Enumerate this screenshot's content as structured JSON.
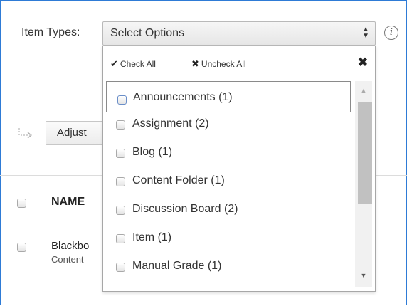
{
  "filter": {
    "label": "Item Types:",
    "select_value": "Select Options",
    "select_arrows": "▲\n▼",
    "info_glyph": "i"
  },
  "toolbar": {
    "adjust_label": "Adjust"
  },
  "table": {
    "name_header": "NAME",
    "rows": [
      {
        "title": "Blackbo",
        "subtitle": "Content"
      }
    ]
  },
  "dropdown": {
    "check_all": {
      "glyph": "✔",
      "label": "Check All"
    },
    "uncheck_all": {
      "glyph": "✖",
      "label": "Uncheck All"
    },
    "close_glyph": "✖",
    "options": [
      {
        "label": "Announcements (1)",
        "checked": false
      },
      {
        "label": "Assignment (2)",
        "checked": false
      },
      {
        "label": "Blog (1)",
        "checked": false
      },
      {
        "label": "Content Folder (1)",
        "checked": false
      },
      {
        "label": "Discussion Board (2)",
        "checked": false
      },
      {
        "label": "Item (1)",
        "checked": false
      },
      {
        "label": "Manual Grade (1)",
        "checked": false
      }
    ],
    "scroll_up_glyph": "▲",
    "scroll_down_glyph": "▼"
  },
  "colors": {
    "frame_border": "#2e7bd6",
    "focus_border": "#8a8a8a"
  }
}
